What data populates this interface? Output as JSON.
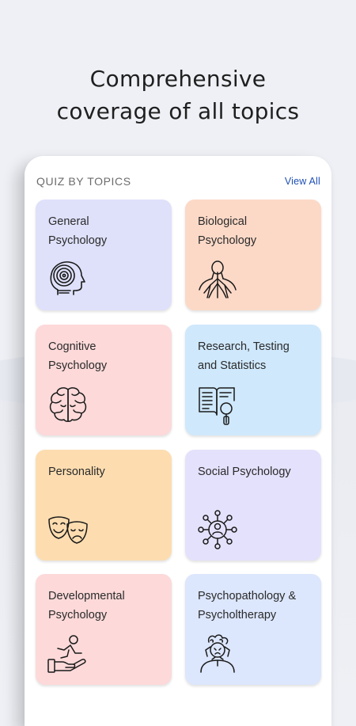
{
  "headline": {
    "line1": "Comprehensive",
    "line2": "coverage of all topics"
  },
  "section": {
    "title": "QUIZ BY TOPICS",
    "view_all": "View All"
  },
  "topics": [
    {
      "label": "General\nPsychology",
      "icon": "head-target-icon",
      "color": "#dfe1fb"
    },
    {
      "label": "Biological\nPsychology",
      "icon": "nervous-system-icon",
      "color": "#fcd9c7"
    },
    {
      "label": "Cognitive\nPsychology",
      "icon": "brain-icon",
      "color": "#fdd9d9"
    },
    {
      "label": "Research, Testing\nand Statistics",
      "icon": "book-magnifier-icon",
      "color": "#cfe8fc"
    },
    {
      "label": "Personality",
      "icon": "theater-masks-icon",
      "color": "#fdddb0"
    },
    {
      "label": "Social Psychology",
      "icon": "social-network-icon",
      "color": "#e4e1fc"
    },
    {
      "label": "Developmental\nPsychology",
      "icon": "hand-child-icon",
      "color": "#fdd9d9"
    },
    {
      "label": "Psychopathology &\nPsycholtherapy",
      "icon": "distressed-person-icon",
      "color": "#dce6fc"
    }
  ]
}
